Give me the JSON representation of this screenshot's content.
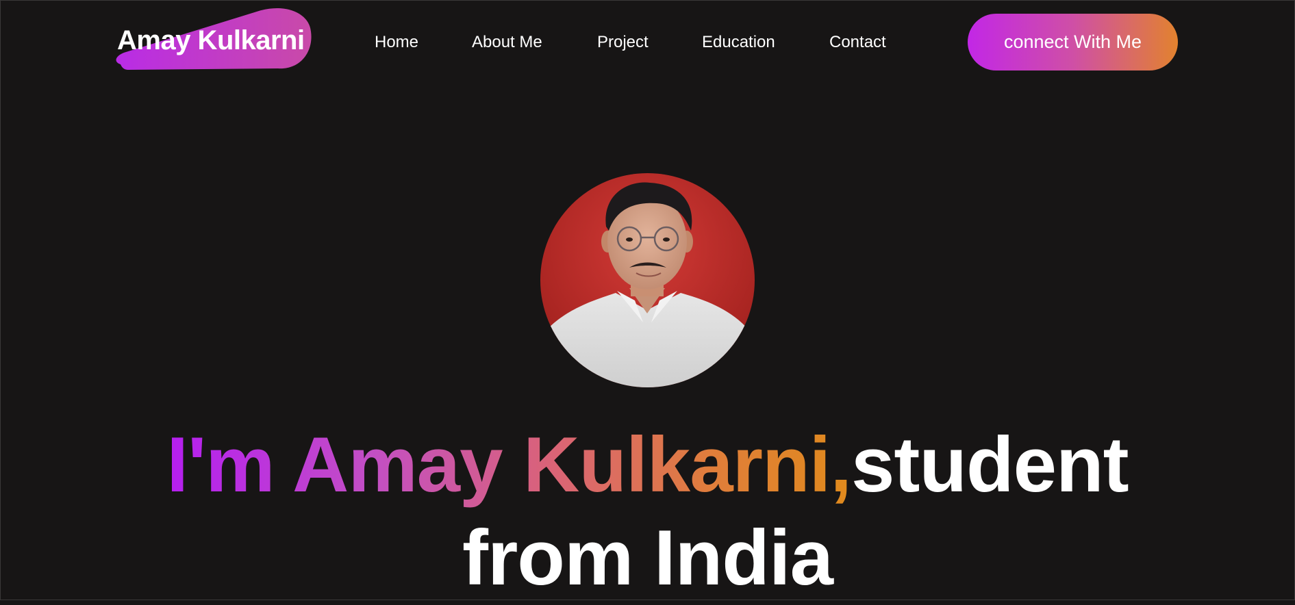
{
  "navbar": {
    "logo_text": "Amay Kulkarni",
    "links": [
      {
        "label": "Home"
      },
      {
        "label": "About Me"
      },
      {
        "label": "Project"
      },
      {
        "label": "Education"
      },
      {
        "label": "Contact"
      }
    ],
    "cta_label": "connect With Me"
  },
  "hero": {
    "avatar_icon": "profile-photo",
    "headline_gradient": "I'm Amay Kulkarni,",
    "headline_line1_rest": "student",
    "headline_line2": "from India"
  },
  "colors": {
    "background": "#171515",
    "accent_purple": "#c227e6",
    "accent_pink": "#cf4fa6",
    "accent_orange": "#e2822e",
    "text": "#ffffff"
  }
}
